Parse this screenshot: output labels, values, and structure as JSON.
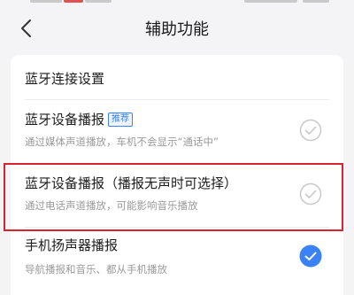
{
  "header": {
    "title": "辅助功能"
  },
  "section": {
    "title": "蓝牙连接设置"
  },
  "options": [
    {
      "label": "蓝牙设备播报",
      "badge": "推荐",
      "description": "通过媒体声道播放，车机不会显示“通话中”",
      "selected": false
    },
    {
      "label": "蓝牙设备播报（播报无声时可选择）",
      "description": "通过电话声道播放，可能影响音乐播放",
      "selected": false
    },
    {
      "label": "手机扬声器播报",
      "description": "导航播报和音乐、都从手机播放",
      "selected": true
    }
  ],
  "colors": {
    "accent": "#3b82f6",
    "highlight": "#d9232d",
    "uncheckedBorder": "#c8c8c8"
  }
}
